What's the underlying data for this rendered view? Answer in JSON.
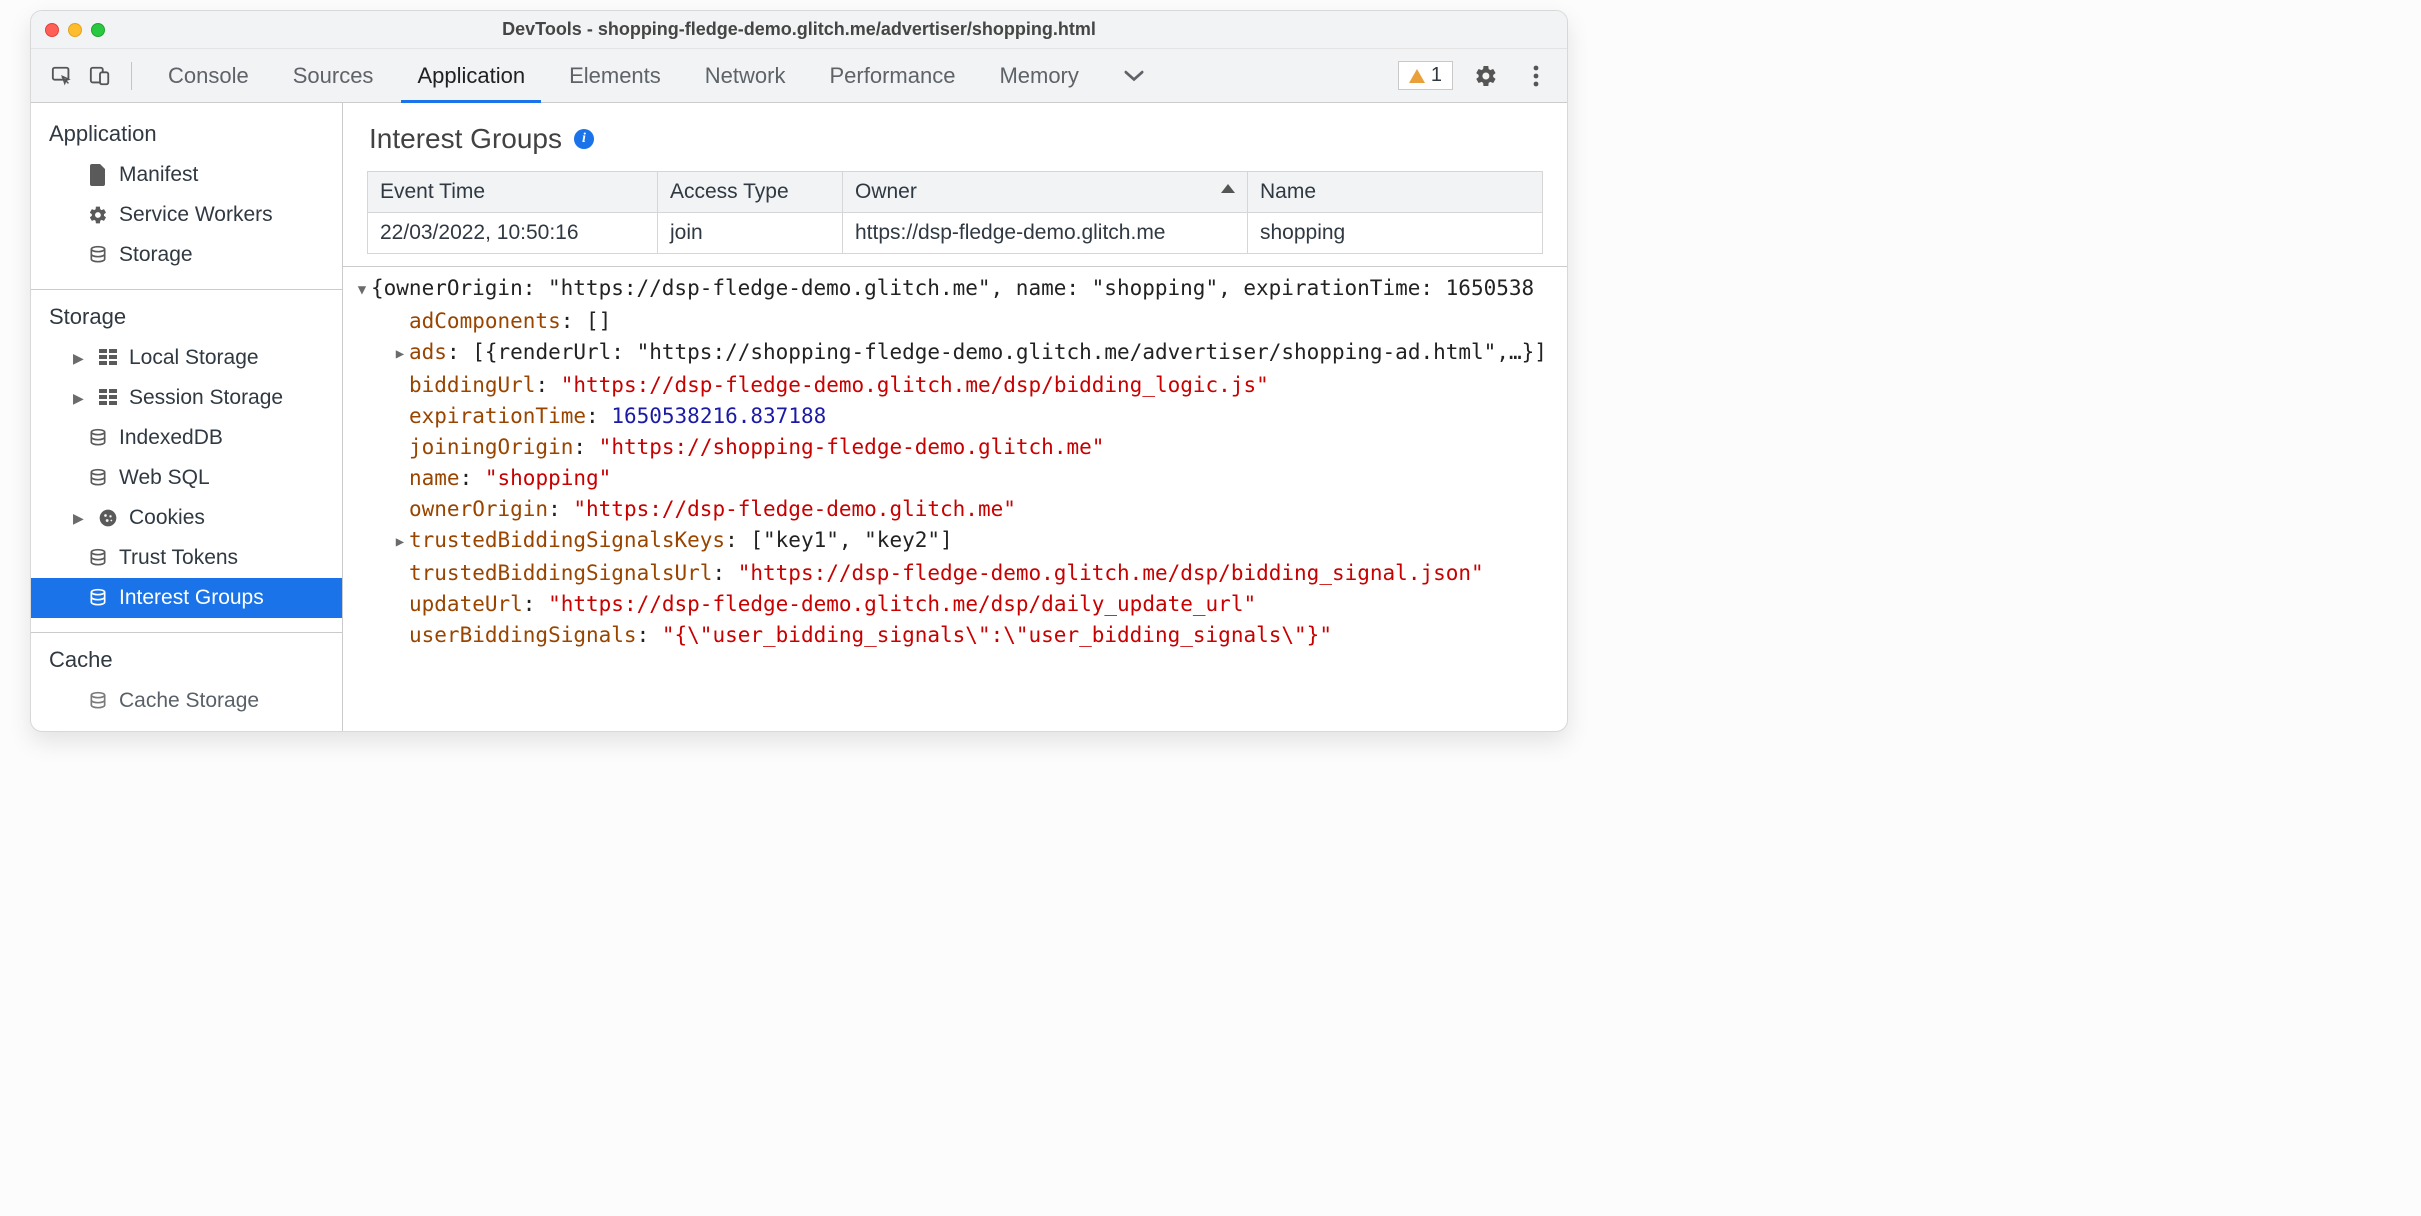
{
  "window_title": "DevTools - shopping-fledge-demo.glitch.me/advertiser/shopping.html",
  "tabs": [
    "Console",
    "Sources",
    "Application",
    "Elements",
    "Network",
    "Performance",
    "Memory"
  ],
  "active_tab": "Application",
  "warning_count": "1",
  "sidebar": {
    "sections": [
      {
        "title": "Application",
        "items": [
          {
            "icon": "doc",
            "label": "Manifest"
          },
          {
            "icon": "gear",
            "label": "Service Workers"
          },
          {
            "icon": "db",
            "label": "Storage"
          }
        ]
      },
      {
        "title": "Storage",
        "items": [
          {
            "icon": "grid",
            "label": "Local Storage",
            "expandable": true
          },
          {
            "icon": "grid",
            "label": "Session Storage",
            "expandable": true
          },
          {
            "icon": "db",
            "label": "IndexedDB"
          },
          {
            "icon": "db",
            "label": "Web SQL"
          },
          {
            "icon": "cookie",
            "label": "Cookies",
            "expandable": true
          },
          {
            "icon": "db",
            "label": "Trust Tokens"
          },
          {
            "icon": "db",
            "label": "Interest Groups",
            "selected": true
          }
        ]
      },
      {
        "title": "Cache",
        "items": [
          {
            "icon": "db",
            "label": "Cache Storage"
          }
        ]
      }
    ]
  },
  "panel_title": "Interest Groups",
  "table": {
    "headers": [
      "Event Time",
      "Access Type",
      "Owner",
      "Name"
    ],
    "sort_col": 2,
    "rows": [
      [
        "22/03/2022, 10:50:16",
        "join",
        "https://dsp-fledge-demo.glitch.me",
        "shopping"
      ]
    ]
  },
  "json": {
    "summary": "{ownerOrigin: \"https://dsp-fledge-demo.glitch.me\", name: \"shopping\", expirationTime: 1650538",
    "adComponents": "[]",
    "ads_summary": "[{renderUrl: \"https://shopping-fledge-demo.glitch.me/advertiser/shopping-ad.html\",…}]",
    "biddingUrl": "\"https://dsp-fledge-demo.glitch.me/dsp/bidding_logic.js\"",
    "expirationTime": "1650538216.837188",
    "joiningOrigin": "\"https://shopping-fledge-demo.glitch.me\"",
    "name": "\"shopping\"",
    "ownerOrigin": "\"https://dsp-fledge-demo.glitch.me\"",
    "trustedBiddingSignalsKeys": "[\"key1\", \"key2\"]",
    "trustedBiddingSignalsUrl": "\"https://dsp-fledge-demo.glitch.me/dsp/bidding_signal.json\"",
    "updateUrl": "\"https://dsp-fledge-demo.glitch.me/dsp/daily_update_url\"",
    "userBiddingSignals": "\"{\\\"user_bidding_signals\\\":\\\"user_bidding_signals\\\"}\""
  }
}
